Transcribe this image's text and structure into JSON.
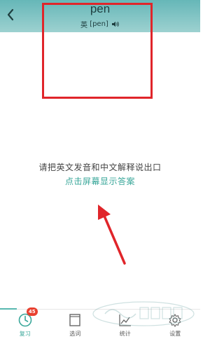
{
  "header": {
    "word": "pen",
    "phonetic_label": "英",
    "phonetic": "[pen]"
  },
  "icons": {
    "back": "chevron-left-icon",
    "speaker": "speaker-icon"
  },
  "prompt": {
    "instruction": "请把英文发音和中文解释说出口",
    "reveal_link": "点击屏幕显示答案"
  },
  "nav": {
    "items": [
      {
        "label": "复习",
        "icon": "review-icon",
        "badge": "45",
        "active": true
      },
      {
        "label": "选词",
        "icon": "book-icon",
        "active": false
      },
      {
        "label": "统计",
        "icon": "chart-icon",
        "active": false
      },
      {
        "label": "设置",
        "icon": "gear-icon",
        "active": false
      }
    ]
  },
  "watermark": {
    "text": "系统之家"
  },
  "colors": {
    "header_top": "#66b7b8",
    "header_bottom": "#9dd1d0",
    "accent": "#3aa79a",
    "annotation_red": "#e0252a",
    "badge": "#e8402f"
  }
}
